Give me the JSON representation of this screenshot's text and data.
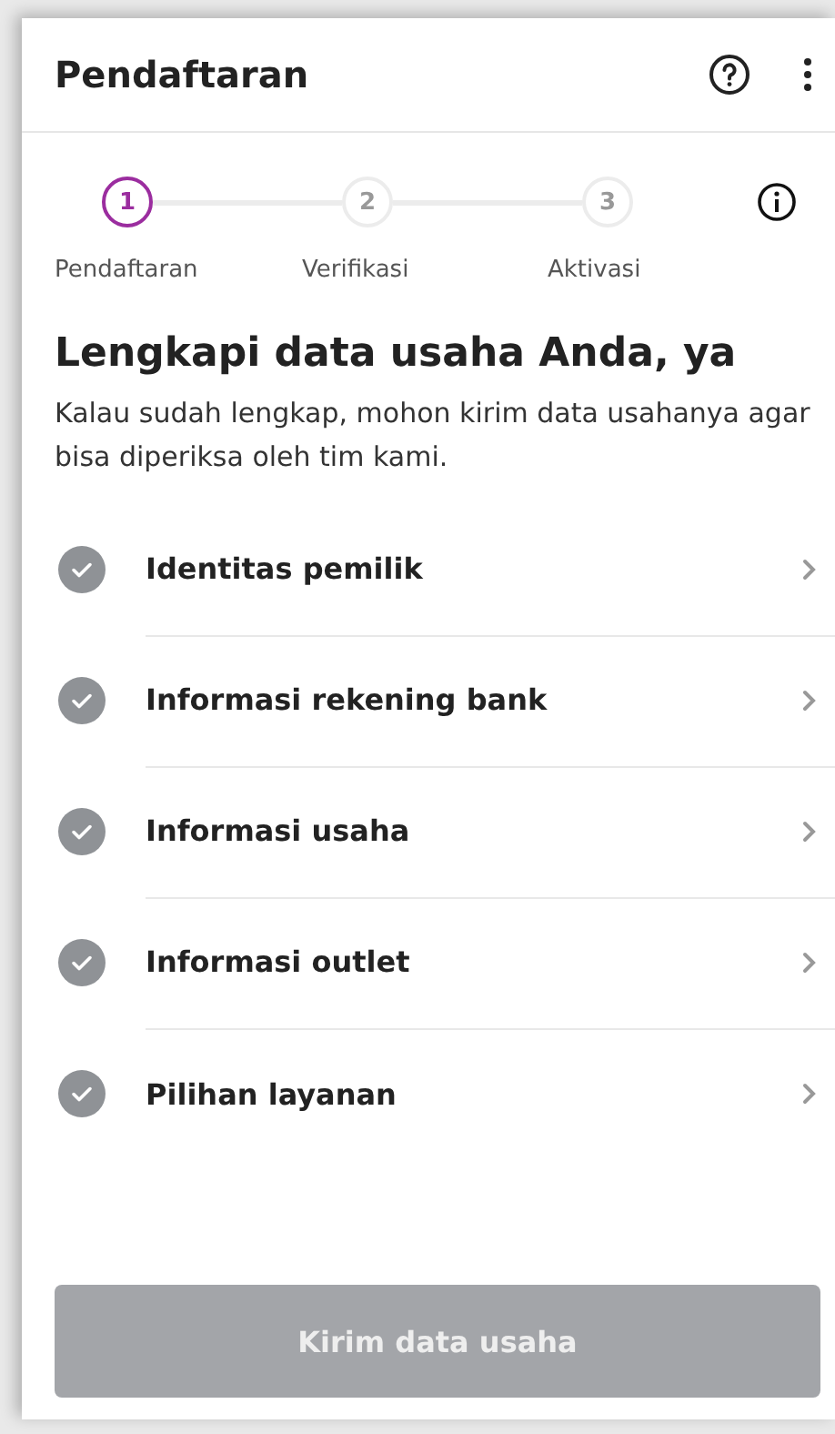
{
  "header": {
    "title": "Pendaftaran"
  },
  "steps": [
    {
      "number": "1",
      "label": "Pendaftaran",
      "selected": true
    },
    {
      "number": "2",
      "label": "Verifikasi",
      "selected": false
    },
    {
      "number": "3",
      "label": "Aktivasi",
      "selected": false
    }
  ],
  "heading": "Lengkapi data usaha Anda, ya",
  "description": "Kalau sudah lengkap, mohon kirim data usahanya agar bisa diperiksa oleh tim kami.",
  "items": [
    {
      "label": "Identitas pemilik",
      "done": false
    },
    {
      "label": "Informasi rekening bank",
      "done": false
    },
    {
      "label": "Informasi usaha",
      "done": false
    },
    {
      "label": "Informasi outlet",
      "done": false
    },
    {
      "label": "Pilihan layanan",
      "done": false
    }
  ],
  "submit": {
    "label": "Kirim data usaha",
    "disabled": true
  }
}
